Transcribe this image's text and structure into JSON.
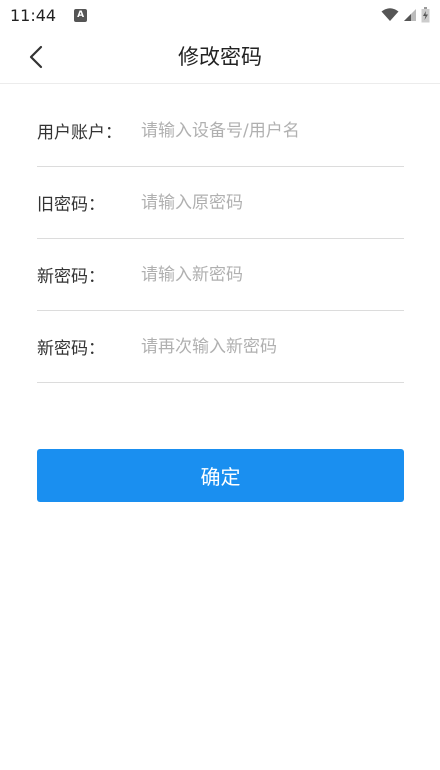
{
  "status_bar": {
    "time": "11:44",
    "notification_icon": "A"
  },
  "header": {
    "title": "修改密码",
    "back_icon": "chevron-left-icon"
  },
  "form": {
    "fields": [
      {
        "label": "用户账户：",
        "placeholder": "请输入设备号/用户名",
        "value": ""
      },
      {
        "label": "旧密码：",
        "placeholder": "请输入原密码",
        "value": ""
      },
      {
        "label": "新密码：",
        "placeholder": "请输入新密码",
        "value": ""
      },
      {
        "label": "新密码：",
        "placeholder": "请再次输入新密码",
        "value": ""
      }
    ]
  },
  "confirm_label": "确定",
  "colors": {
    "primary": "#1a8ff0",
    "placeholder": "#b0b0b0",
    "divider": "#dcdcdc"
  }
}
